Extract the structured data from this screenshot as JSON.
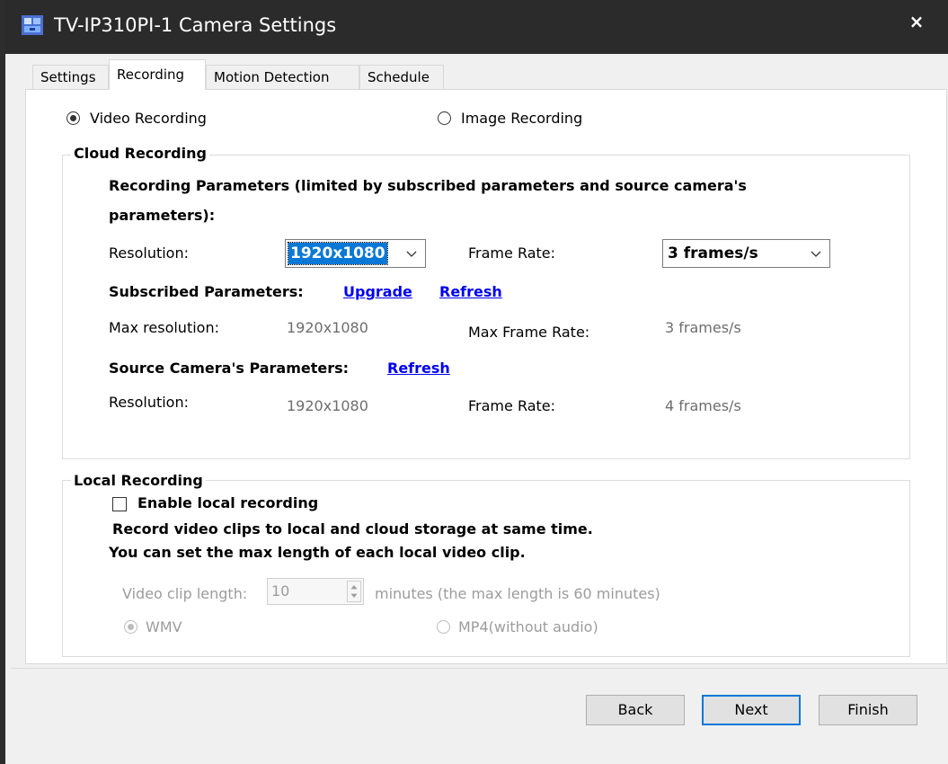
{
  "window": {
    "title": "TV-IP310PI-1 Camera Settings",
    "close_label": "×"
  },
  "tabs": [
    {
      "label": "Settings",
      "active": false
    },
    {
      "label": "Recording",
      "active": true
    },
    {
      "label": "Motion Detection",
      "active": false
    },
    {
      "label": "Schedule",
      "active": false
    }
  ],
  "mode": {
    "video_label": "Video Recording",
    "image_label": "Image Recording",
    "selected": "video"
  },
  "cloud": {
    "group_title": "Cloud Recording",
    "params_heading_line1": "Recording Parameters (limited by subscribed parameters and source camera's",
    "params_heading_line2": "parameters):",
    "resolution_label": "Resolution:",
    "resolution_value": "1920x1080",
    "frame_rate_label": "Frame Rate:",
    "frame_rate_value": "3 frames/s",
    "subscribed_heading": "Subscribed Parameters:",
    "upgrade_link": "Upgrade",
    "refresh_link": "Refresh",
    "max_resolution_label": "Max resolution:",
    "max_resolution_value": "1920x1080",
    "max_frame_rate_label": "Max Frame Rate:",
    "max_frame_rate_value": "3 frames/s",
    "source_heading": "Source  Camera's Parameters:",
    "source_refresh_link": "Refresh",
    "source_resolution_label": "Resolution:",
    "source_resolution_value": "1920x1080",
    "source_frame_rate_label": "Frame Rate:",
    "source_frame_rate_value": "4 frames/s"
  },
  "local": {
    "group_title": "Local Recording",
    "enable_label": "Enable local recording",
    "enable_checked": false,
    "desc_line1": "Record video clips to local and cloud storage at same time.",
    "desc_line2": "You can set the max length of each local video clip.",
    "clip_length_label": "Video clip length:",
    "clip_length_value": "10",
    "clip_length_suffix": "minutes (the max length is 60 minutes)",
    "format_wmv": "WMV",
    "format_mp4": "MP4(without audio)",
    "format_selected": "wmv"
  },
  "buttons": {
    "back": "Back",
    "next": "Next",
    "finish": "Finish"
  },
  "colors": {
    "titlebar": "#2b2b2b",
    "link": "#0000ee",
    "selection": "#0a78d7",
    "primary_border": "#0078d7"
  }
}
